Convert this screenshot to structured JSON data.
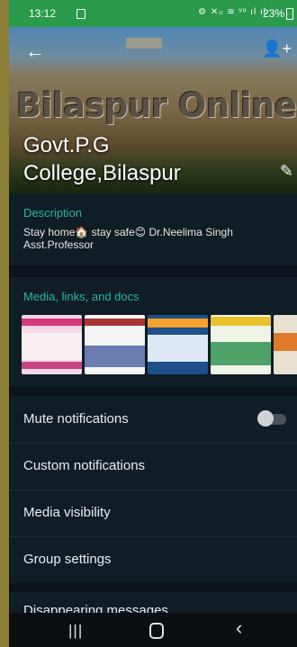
{
  "status_bar": {
    "time": "13:12",
    "icons": "⚙ ✕ᵢₗ ≋ ᵛᵒ ıl ıl",
    "battery": "23%"
  },
  "header": {
    "banner_text": "Bilaspur Online",
    "group_name_line1": "Govt.P.G",
    "group_name_line2": "College,Bilaspur",
    "back_icon": "←",
    "add_icon": "👤+",
    "edit_icon": "✎"
  },
  "description": {
    "label": "Description",
    "line1": "Stay home🏠 stay safe😊    Dr.Neelima Singh",
    "line2": "Asst.Professor"
  },
  "media": {
    "label": "Media, links, and docs"
  },
  "settings": [
    {
      "label": "Mute notifications"
    },
    {
      "label": "Custom notifications"
    },
    {
      "label": "Media visibility"
    },
    {
      "label": "Group settings"
    },
    {
      "label": "Disappearing messages"
    }
  ],
  "nav": {
    "recents": "|||",
    "back": "‹"
  },
  "colors": {
    "accent": "#25b79d",
    "status_bar": "#2a9a4c",
    "background": "#121b22"
  }
}
